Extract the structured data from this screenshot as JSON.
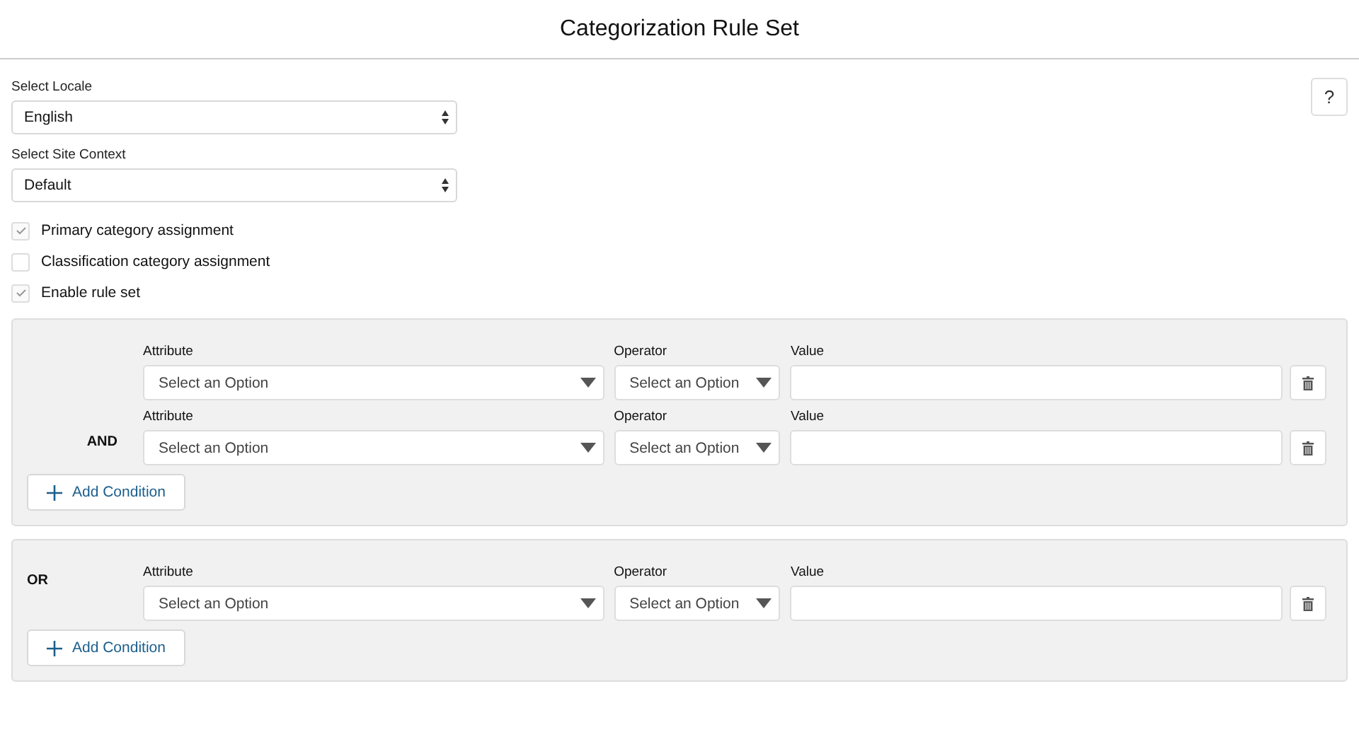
{
  "window": {
    "title": "Categorization Rule Set"
  },
  "help_button": {
    "label": "?"
  },
  "selects": [
    {
      "label": "Select Locale",
      "value": "English"
    },
    {
      "label": "Select Site Context",
      "value": "Default"
    }
  ],
  "checkboxes": [
    {
      "label": "Primary category assignment",
      "checked": true
    },
    {
      "label": "Classification category assignment",
      "checked": false
    },
    {
      "label": "Enable rule set",
      "checked": true
    }
  ],
  "groups": [
    {
      "conditions": [
        {
          "attribute_label": "Attribute",
          "attribute_placeholder": "Select an Option",
          "operator_label": "Operator",
          "operator_placeholder": "Select an Option",
          "value_label": "Value"
        },
        {
          "connector": "AND",
          "attribute_label": "Attribute",
          "attribute_placeholder": "Select an Option",
          "operator_label": "Operator",
          "operator_placeholder": "Select an Option",
          "value_label": "Value"
        }
      ],
      "add_button": "Add Condition"
    },
    {
      "connector": "OR",
      "conditions": [
        {
          "attribute_label": "Attribute",
          "attribute_placeholder": "Select an Option",
          "operator_label": "Operator",
          "operator_placeholder": "Select an Option",
          "value_label": "Value"
        }
      ],
      "add_button": "Add Condition"
    }
  ]
}
